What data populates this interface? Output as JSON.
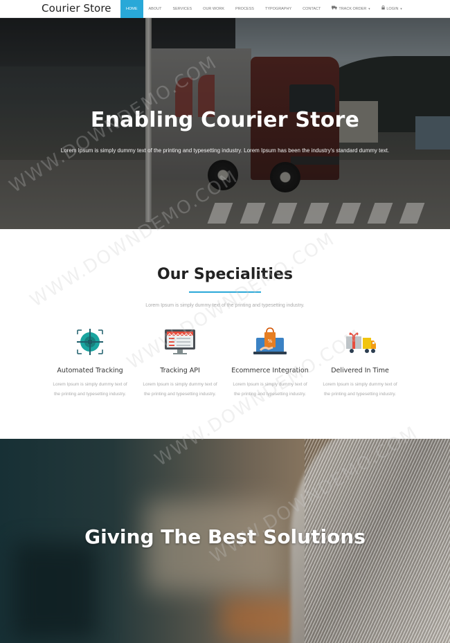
{
  "brand": "Courier Store",
  "nav": [
    {
      "label": "HOME",
      "active": true
    },
    {
      "label": "ABOUT"
    },
    {
      "label": "SERVICES"
    },
    {
      "label": "OUR WORK"
    },
    {
      "label": "PROCESS"
    },
    {
      "label": "TYPOGRAPHY"
    },
    {
      "label": "CONTACT"
    },
    {
      "label": "TRACK ORDER",
      "icon": "truck-icon",
      "dropdown": true
    },
    {
      "label": "LOGIN",
      "icon": "lock-icon",
      "dropdown": true
    }
  ],
  "hero": {
    "title": "Enabling Courier Store",
    "subtitle": "Lorem Ipsum is simply dummy text of the printing and typesetting industry. Lorem Ipsum has been the industry's standard dummy text."
  },
  "specialities": {
    "title": "Our Specialities",
    "subtitle": "Lorem Ipsum is simply dummy text of the printing and typesetting industry.",
    "cards": [
      {
        "title": "Automated Tracking",
        "text": "Lorem Ipsum is simply dummy text of the printing and typesetting industry.",
        "icon": "target-icon"
      },
      {
        "title": "Tracking API",
        "text": "Lorem Ipsum is simply dummy text of the printing and typesetting industry.",
        "icon": "monitor-icon"
      },
      {
        "title": "Ecommerce Integration",
        "text": "Lorem Ipsum is simply dummy text of the printing and typesetting industry.",
        "icon": "shopping-bag-icon"
      },
      {
        "title": "Delivered In Time",
        "text": "Lorem Ipsum is simply dummy text of the printing and typesetting industry.",
        "icon": "gift-truck-icon"
      }
    ]
  },
  "solutions": {
    "title": "Giving The Best Solutions"
  },
  "watermark": "WWW.DOWNDEMO.COM",
  "colors": {
    "accent": "#29a8d8",
    "text_dark": "#222222",
    "text_muted": "#aaaaaa"
  }
}
